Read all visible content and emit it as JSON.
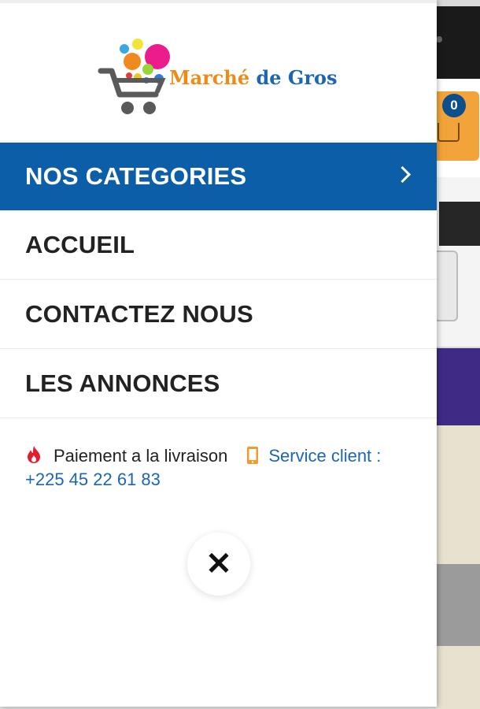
{
  "brand": {
    "name_part1": "Marché",
    "name_part2": "de Gros"
  },
  "menu": {
    "items": [
      {
        "label": "NOS CATEGORIES",
        "active": true,
        "has_submenu": true
      },
      {
        "label": "ACCUEIL",
        "active": false
      },
      {
        "label": "CONTACTEZ NOUS",
        "active": false
      },
      {
        "label": "LES ANNONCES",
        "active": false
      }
    ]
  },
  "info": {
    "payment_text": "Paiement a la livraison",
    "service_text": "Service client : +225 45 22 61 83"
  },
  "close_button": {
    "icon": "close-icon",
    "label": "✕"
  },
  "background": {
    "cart_count": "0"
  },
  "colors": {
    "primary": "#0d5ea8",
    "logo_blue": "#1c66b4",
    "logo_orange": "#ef8a16",
    "fire": "#e11d2e",
    "phone": "#f29a2e"
  }
}
